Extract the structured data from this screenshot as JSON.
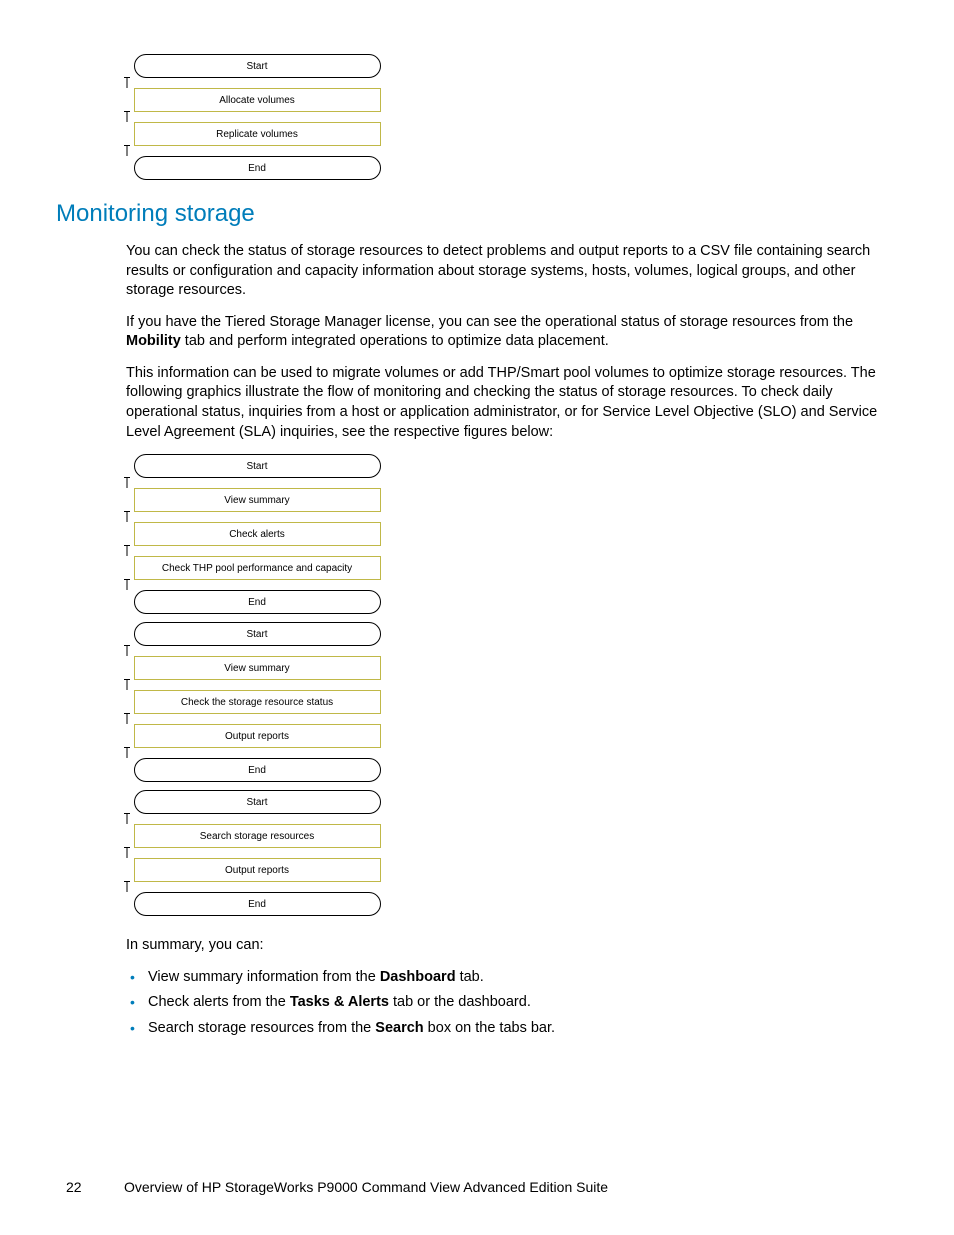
{
  "flow1": {
    "steps": [
      "Start",
      "Allocate volumes",
      "Replicate volumes",
      "End"
    ],
    "types": [
      "terminal",
      "process",
      "process",
      "terminal"
    ]
  },
  "heading": "Monitoring storage",
  "para1": "You can check the status of storage resources to detect problems and output reports to a CSV file containing search results or configuration and capacity information about storage systems, hosts, volumes, logical groups, and other storage resources.",
  "para2_pre": "If you have the Tiered Storage Manager license, you can see the operational status of storage resources from the ",
  "para2_bold": "Mobility",
  "para2_post": " tab and perform integrated operations to optimize data placement.",
  "para3": "This information can be used to migrate volumes or add THP/Smart pool volumes to optimize storage resources. The following graphics illustrate the flow of monitoring and checking the status of storage resources. To check daily operational status, inquiries from a host or application administrator, or for Service Level Objective (SLO) and Service Level Agreement (SLA) inquiries, see the respective figures below:",
  "flow2": {
    "steps": [
      "Start",
      "View summary",
      "Check alerts",
      "Check THP pool performance and capacity",
      "End"
    ],
    "types": [
      "terminal",
      "process",
      "process",
      "process",
      "terminal"
    ]
  },
  "flow3": {
    "steps": [
      "Start",
      "View summary",
      "Check the storage resource status",
      "Output reports",
      "End"
    ],
    "types": [
      "terminal",
      "process",
      "process",
      "process",
      "terminal"
    ]
  },
  "flow4": {
    "steps": [
      "Start",
      "Search storage resources",
      "Output reports",
      "End"
    ],
    "types": [
      "terminal",
      "process",
      "process",
      "terminal"
    ]
  },
  "summary_intro": "In summary, you can:",
  "summary": [
    {
      "pre": "View summary information from the ",
      "bold": "Dashboard",
      "post": " tab."
    },
    {
      "pre": "Check alerts from the ",
      "bold": "Tasks & Alerts",
      "post": " tab or the dashboard."
    },
    {
      "pre": "Search storage resources from the ",
      "bold": "Search",
      "post": " box on the tabs bar."
    }
  ],
  "footer": {
    "page": "22",
    "title": "Overview of HP StorageWorks P9000 Command View Advanced Edition Suite"
  }
}
